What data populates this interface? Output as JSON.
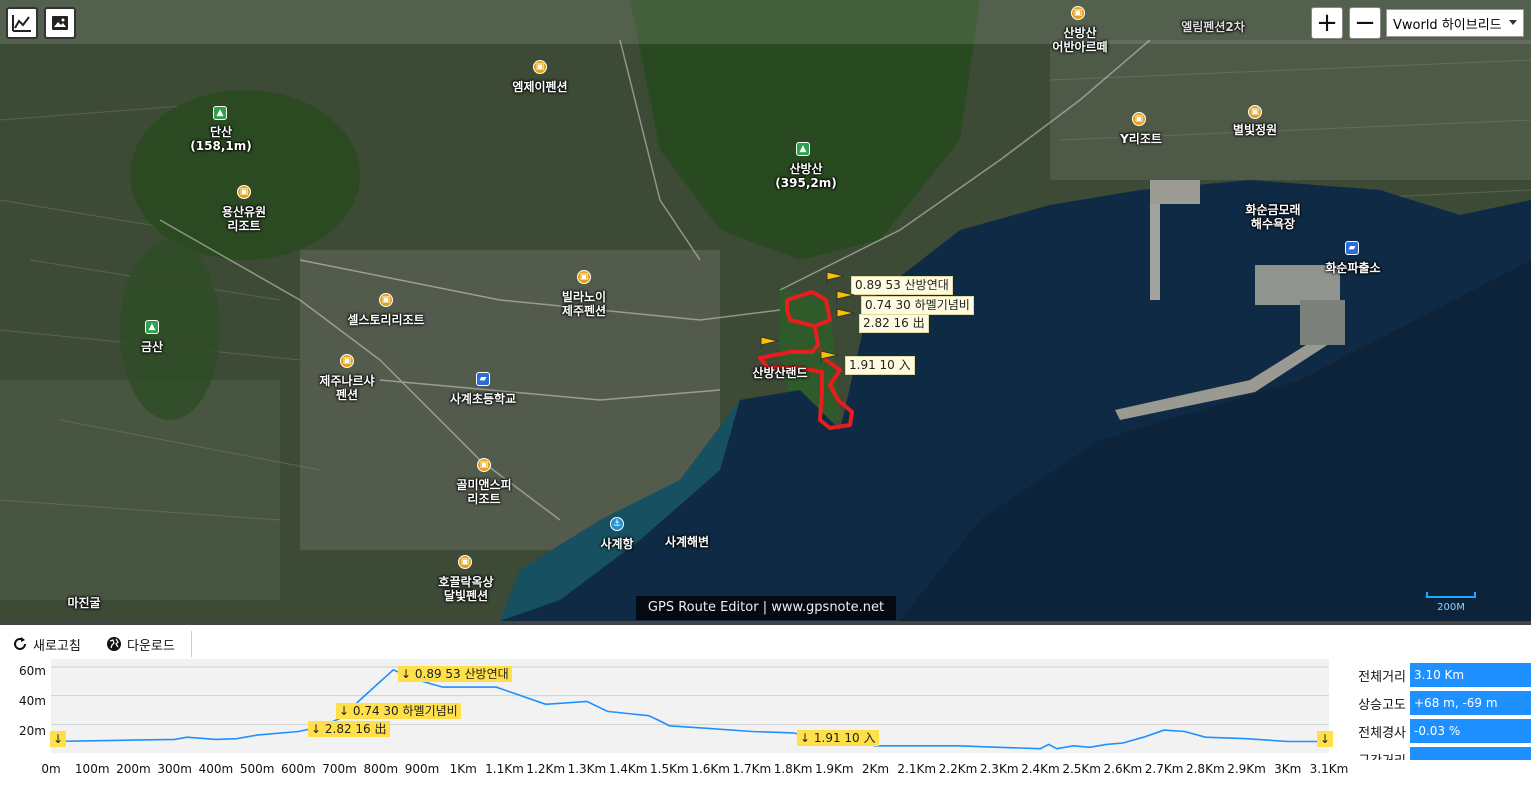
{
  "map": {
    "layer_select": "Vworld 하이브리드",
    "zoom_in": "+",
    "zoom_out": "−",
    "credit": "GPS Route Editor | www.gpsnote.net",
    "scale_label": "200M",
    "places": {
      "dansan": "단산\n(158,1m)",
      "sanbangsan": "산방산\n(395,2m)",
      "geumsan": "금산",
      "emje": "엠제이펜션",
      "yongsan": "용산유원\n리조트",
      "shell": "셀스토리리조트",
      "villa": "빌라노이\n제주펜션",
      "jeju_nara": "제주나르샤\n펜션",
      "school": "사계초등학교",
      "gomi": "골미앤스피\n리조트",
      "sagye_port": "사계항",
      "sagye_beach": "사계해변",
      "hogeul": "호끌락옥상\n달빛펜션",
      "majin": "마진굴",
      "sanbang_top": "산방산\n어반아르떼",
      "ellim": "엘림펜션2차",
      "y_resort": "Y리조트",
      "byeolbit": "별빛정원",
      "hwasun_beach": "화순금모래\n해수욕장",
      "hwasun_police": "화순파출소",
      "sanbang_land": "산방산랜드"
    },
    "waypoints": {
      "wp1": "0.89  53  산방연대",
      "wp2": "0.74  30  하멜기념비",
      "wp3": "2.82  16  出",
      "wp4": "1.91  10  入"
    },
    "icons": {
      "chart": "line-chart-icon",
      "image": "image-icon"
    }
  },
  "toolbar": {
    "refresh": "새로고침",
    "download": "다운로드"
  },
  "profile": {
    "y_labels": [
      "60m",
      "40m",
      "20m"
    ],
    "x_labels": [
      "0m",
      "100m",
      "200m",
      "300m",
      "400m",
      "500m",
      "600m",
      "700m",
      "800m",
      "900m",
      "1Km",
      "1.1Km",
      "1.2Km",
      "1.3Km",
      "1.4Km",
      "1.5Km",
      "1.6Km",
      "1.7Km",
      "1.8Km",
      "1.9Km",
      "2Km",
      "2.1Km",
      "2.2Km",
      "2.3Km",
      "2.4Km",
      "2.5Km",
      "2.6Km",
      "2.7Km",
      "2.8Km",
      "2.9Km",
      "3Km",
      "3.1Km"
    ],
    "markers": {
      "m_start": "↓",
      "m_wp1": "↓  0.89  53  산방연대",
      "m_wp2": "↓  0.74  30  하멜기념비",
      "m_wp3": "↓  2.82  16  出",
      "m_wp4": "↓  1.91  10  入",
      "m_end": "↓"
    }
  },
  "chart_data": {
    "type": "area",
    "x": [
      0,
      100,
      200,
      300,
      330,
      400,
      450,
      500,
      600,
      650,
      700,
      780,
      830,
      900,
      950,
      1000,
      1080,
      1200,
      1300,
      1350,
      1450,
      1480,
      1500,
      1600,
      1700,
      1800,
      1850,
      1950,
      2000,
      2100,
      2200,
      2300,
      2400,
      2420,
      2440,
      2480,
      2520,
      2560,
      2600,
      2650,
      2700,
      2750,
      2800,
      2900,
      3000,
      3100
    ],
    "y": [
      8,
      8.5,
      9,
      9.5,
      11,
      9.5,
      10,
      12.5,
      15,
      18,
      24,
      45,
      58,
      50,
      46,
      46,
      46,
      34,
      36,
      29,
      26,
      22,
      19,
      17,
      15,
      14,
      11,
      8,
      5,
      5,
      5,
      4,
      3,
      6,
      3,
      5,
      4,
      6,
      7,
      11,
      16,
      15,
      11,
      10,
      8,
      8
    ],
    "xlim": [
      0,
      3100
    ],
    "ylim": [
      0,
      60
    ],
    "grid": true
  },
  "stats": [
    {
      "label": "전체거리",
      "value": "3.10 Km"
    },
    {
      "label": "상승고도",
      "value": "+68 m, -69 m"
    },
    {
      "label": "전체경사",
      "value": "-0.03 %"
    },
    {
      "label": "구간거리",
      "value": ""
    }
  ]
}
